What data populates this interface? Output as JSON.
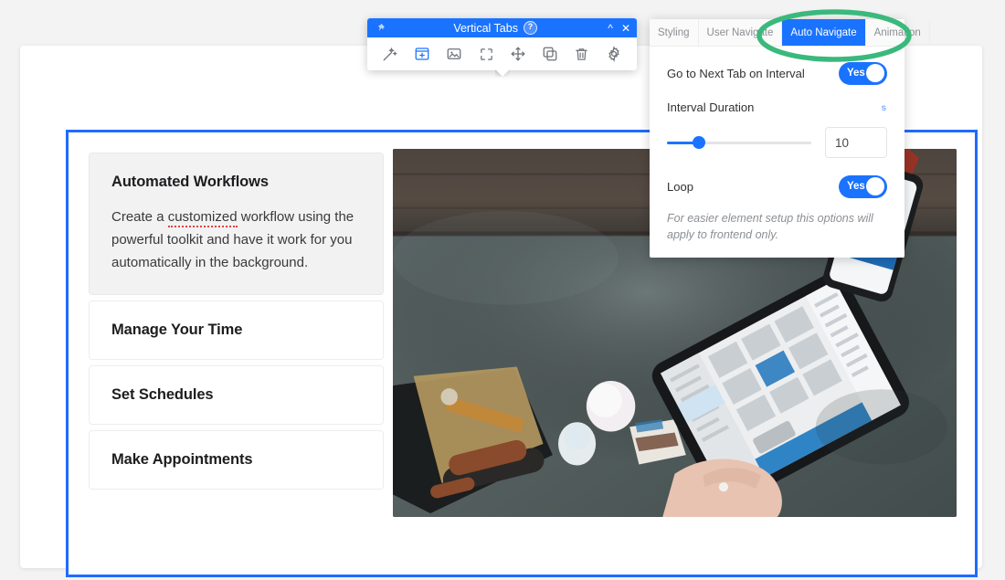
{
  "toolbar": {
    "pin_icon": "pushpin-icon",
    "title": "Vertical Tabs",
    "help_badge": "?",
    "collapse_icon": "chevron-up-icon",
    "close_icon": "close-icon",
    "actions": [
      {
        "name": "magic-wand-icon",
        "label": "Magic Wand",
        "active": false
      },
      {
        "name": "add-block-icon",
        "label": "Add Block",
        "active": true
      },
      {
        "name": "image-icon",
        "label": "Image",
        "active": false
      },
      {
        "name": "fullscreen-icon",
        "label": "Fullscreen",
        "active": false
      },
      {
        "name": "move-icon",
        "label": "Move",
        "active": false
      },
      {
        "name": "duplicate-icon",
        "label": "Duplicate",
        "active": false
      },
      {
        "name": "trash-icon",
        "label": "Delete",
        "active": false
      },
      {
        "name": "gear-icon",
        "label": "Settings",
        "active": false
      }
    ]
  },
  "settings": {
    "tabs": [
      {
        "label": "Styling",
        "selected": false
      },
      {
        "label": "User Navigate",
        "selected": false
      },
      {
        "label": "Auto Navigate",
        "selected": true
      },
      {
        "label": "Animation",
        "selected": false
      }
    ],
    "next_tab": {
      "label": "Go to Next Tab on Interval",
      "toggle_value": "Yes"
    },
    "interval": {
      "label": "Interval Duration",
      "unit": "s",
      "value": "10",
      "slider_percent": 22
    },
    "loop": {
      "label": "Loop",
      "toggle_value": "Yes"
    },
    "note": "For easier element setup this options will apply to frontend only."
  },
  "annotation": {
    "shape": "ellipse-highlight",
    "color": "#3ab97c",
    "target": "Auto Navigate"
  },
  "element": {
    "accent_color": "#1f6bff",
    "tabs": [
      {
        "title": "Automated Workflows",
        "active": true,
        "body_before": "Create a ",
        "body_misspelled": "customized",
        "body_after": " workflow using the powerful toolkit and have it work for you automatically in the background."
      },
      {
        "title": "Manage Your Time",
        "active": false
      },
      {
        "title": "Set Schedules",
        "active": false
      },
      {
        "title": "Make Appointments",
        "active": false
      }
    ],
    "photo_alt": "Overhead photo of a desk with tablet, phone, hairbrush and products"
  }
}
